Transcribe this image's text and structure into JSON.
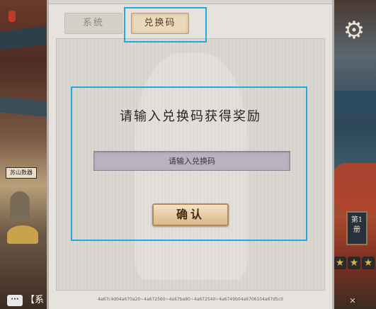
{
  "tabs": {
    "system_label": "系统",
    "redeem_label": "兑换码"
  },
  "redeem": {
    "heading": "请输入兑换码获得奖励",
    "input_placeholder": "请输入兑换码",
    "confirm_label": "确认"
  },
  "footer": {
    "device_id": "4a67c4d04a670a20~4a672560~4a67ba80~4a672540~4a6749b04a6706104a67d5c0"
  },
  "background": {
    "shop_sign": "苏山数器",
    "book_label": "第1册",
    "gear_icon": "gear-icon",
    "star_count": 3
  },
  "chat": {
    "icon_label": "···",
    "text": "【系"
  },
  "colors": {
    "highlight": "#25a7e0",
    "panel_bg": "#e6e2de",
    "button_text": "#4a2a14"
  }
}
